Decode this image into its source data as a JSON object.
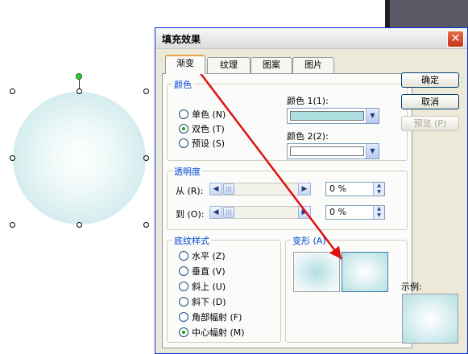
{
  "dialog": {
    "title": "填充效果",
    "close_glyph": "✕",
    "tabs": [
      {
        "label": "渐变"
      },
      {
        "label": "纹理"
      },
      {
        "label": "图案"
      },
      {
        "label": "图片"
      }
    ],
    "colors_group": {
      "label": "颜色",
      "options": [
        {
          "label": "单色 (N)",
          "checked": false
        },
        {
          "label": "双色 (T)",
          "checked": true
        },
        {
          "label": "预设 (S)",
          "checked": false
        }
      ],
      "color1_label": "颜色 1(1):",
      "color2_label": "颜色 2(2):",
      "color1_value": "#aee0e2",
      "color2_value": "#ffffff"
    },
    "transparency_group": {
      "label": "透明度",
      "from_label": "从 (R):",
      "to_label": "到 (O):",
      "from_value": "0 %",
      "to_value": "0 %"
    },
    "shading_group": {
      "label": "底纹样式",
      "options": [
        {
          "label": "水平 (Z)",
          "checked": false
        },
        {
          "label": "垂直 (V)",
          "checked": false
        },
        {
          "label": "斜上 (U)",
          "checked": false
        },
        {
          "label": "斜下 (D)",
          "checked": false
        },
        {
          "label": "角部幅射 (F)",
          "checked": false
        },
        {
          "label": "中心幅射 (M)",
          "checked": true
        }
      ]
    },
    "variants_group": {
      "label": "变形 (A)"
    },
    "buttons": {
      "ok": "确定",
      "cancel": "取消",
      "preview": "预览 (P)"
    },
    "sample_label": "示例:"
  },
  "colors": {
    "annotation_arrow": "#e01010",
    "fill_light": "#ffffff",
    "fill_dark": "#aee0e2"
  }
}
